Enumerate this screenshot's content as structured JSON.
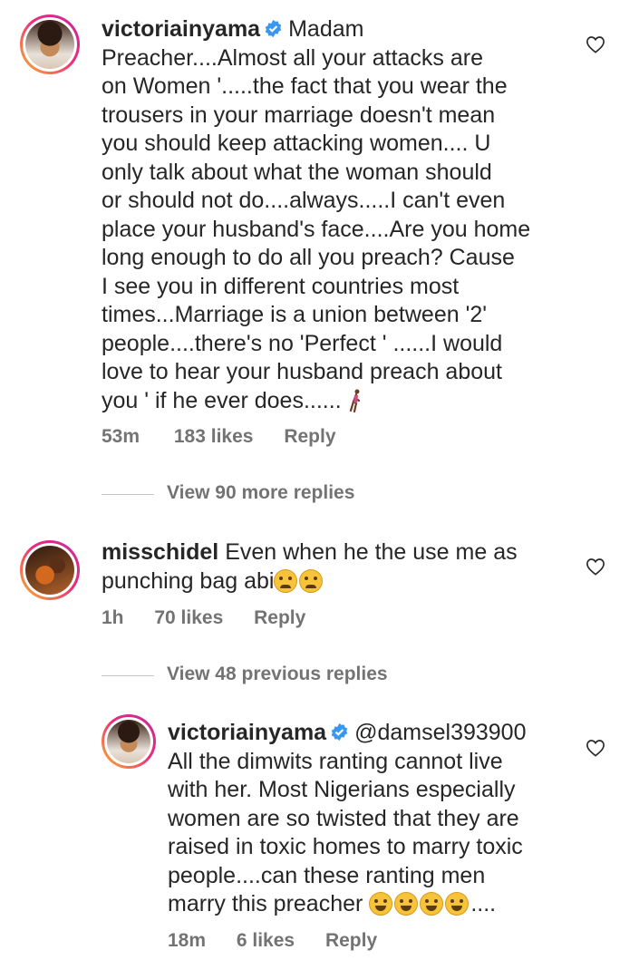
{
  "comments": [
    {
      "username": "victoriainyama",
      "verified": true,
      "text": "Madam\nPreacher....Almost all your attacks are\non Women '.....the fact that you wear the\ntrousers in your marriage doesn't mean\nyou should keep attacking women.... U\nonly talk about what the woman should\nor should not do....always.....I can't even\nplace your husband's face....Are you home\nlong enough to do all you preach? Cause\nI see you in different countries most\ntimes...Marriage is a union between '2'\npeople....there's no 'Perfect ' ......I would\nlove to hear your husband preach about\nyou ' if he ever does......",
      "time": "53m",
      "likes": "183 likes",
      "reply": "Reply",
      "emoji": "person-walking-icon"
    },
    {
      "username": "misschidel",
      "verified": false,
      "text": "Even when he the use me as\npunching bag abi",
      "time": "1h",
      "likes": "70 likes",
      "reply": "Reply",
      "emoji": "sad-face-icon"
    },
    {
      "username": "victoriainyama",
      "verified": true,
      "mention": "@damsel393900",
      "text": "All the dimwits ranting cannot live\nwith her. Most Nigerians especially\nwomen are so twisted that they are\nraised in toxic homes to marry toxic\npeople....can these ranting men\nmarry this preacher",
      "text_suffix": "....",
      "time": "18m",
      "likes": "6 likes",
      "reply": "Reply",
      "emoji": "laughing-face-icon"
    }
  ],
  "view_more_1": "View 90 more replies",
  "view_more_2": "View 48 previous replies",
  "colors": {
    "text": "#262626",
    "meta": "#737373",
    "verified": "#3897f0",
    "divider": "#c7c7c7"
  }
}
